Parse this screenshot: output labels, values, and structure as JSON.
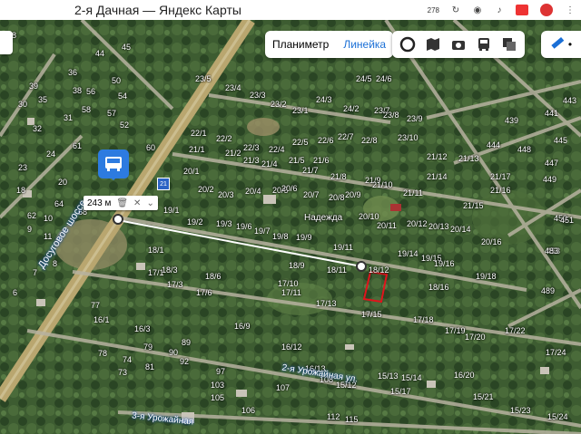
{
  "status": {
    "title": "2-я Дачная — Яндекс Карты",
    "badge_count": "278"
  },
  "toolbar": {
    "planimeter_label": "Планиметр",
    "ruler_label": "Линейка",
    "layer_icons": [
      "circle-icon",
      "panorama-icon",
      "camera-icon",
      "bus-icon",
      "layers-icon"
    ],
    "ruler_icon": "ruler-icon"
  },
  "measure": {
    "distance": "243 м"
  },
  "map": {
    "road_name": "Досуговое шоссе",
    "road_name_2": "2-я Урожайная ул.",
    "road_name_3": "3-я Урожайная",
    "village_label": "Надежда",
    "route_badge": "21",
    "plot_labels": [
      "23/5",
      "23/4",
      "23/3",
      "23/2",
      "23/1",
      "24/5",
      "24/6",
      "24/3",
      "24/2",
      "23/7",
      "23/8",
      "23/9",
      "23/10",
      "22/8",
      "22/7",
      "22/6",
      "22/5",
      "22/4",
      "22/3",
      "22/2",
      "22/1",
      "21/1",
      "21/2",
      "21/3",
      "21/4",
      "21/5",
      "21/6",
      "21/7",
      "21/8",
      "21/9",
      "21/10",
      "21/11",
      "21/12",
      "21/13",
      "21/14",
      "21/15",
      "21/16",
      "21/17",
      "20/1",
      "20/2",
      "20/3",
      "20/4",
      "20/5",
      "20/6",
      "20/7",
      "20/8",
      "20/9",
      "20/10",
      "20/11",
      "20/12",
      "20/13",
      "20/14",
      "20/16",
      "19/1",
      "19/2",
      "19/3",
      "19/6",
      "19/7",
      "19/8",
      "19/9",
      "19/11",
      "19/14",
      "19/15",
      "19/16",
      "19/18",
      "18/1",
      "18/3",
      "18/6",
      "18/9",
      "18/11",
      "18/12",
      "18/16",
      "17/1",
      "17/3",
      "17/6",
      "17/10",
      "17/11",
      "17/13",
      "17/15",
      "17/18",
      "17/19",
      "17/20",
      "17/22",
      "17/24",
      "16/1",
      "16/3",
      "16/9",
      "16/12",
      "16/13",
      "16/20",
      "15/12",
      "15/13",
      "15/14",
      "15/17",
      "15/21",
      "15/23",
      "15/24",
      "439",
      "441",
      "443",
      "444",
      "445",
      "447",
      "448",
      "449",
      "450",
      "451",
      "453",
      "483",
      "489",
      "6",
      "7",
      "8",
      "9",
      "10",
      "11",
      "18",
      "20",
      "23",
      "24",
      "30",
      "31",
      "32",
      "35",
      "36",
      "38",
      "39",
      "44",
      "45",
      "48",
      "50",
      "52",
      "54",
      "56",
      "57",
      "58",
      "60",
      "61",
      "62",
      "64",
      "68",
      "73",
      "74",
      "77",
      "78",
      "79",
      "81",
      "89",
      "90",
      "92",
      "97",
      "103",
      "105",
      "106",
      "107",
      "108",
      "112",
      "115"
    ]
  },
  "colors": {
    "accent": "#1a6fd6",
    "bus_stop": "#2d7be0",
    "plot_outline": "#e0141c",
    "road": "#b9a66f",
    "measure_line": "#ffffff"
  }
}
